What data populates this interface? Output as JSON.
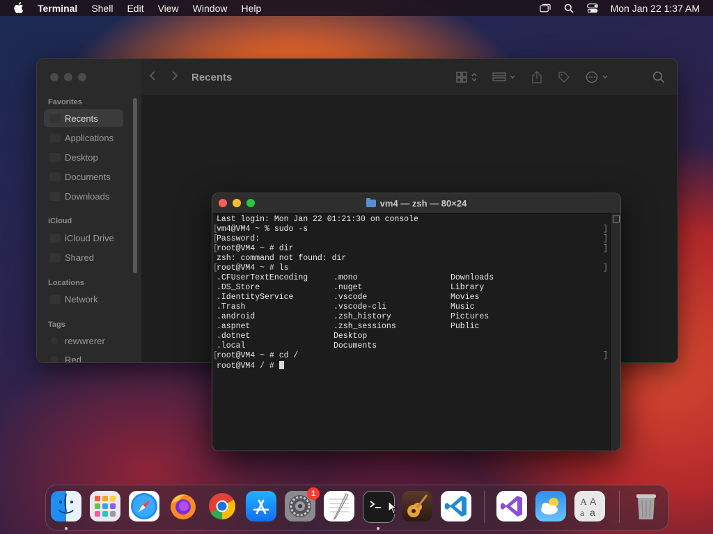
{
  "menubar": {
    "app_name": "Terminal",
    "menus": [
      "Shell",
      "Edit",
      "View",
      "Window",
      "Help"
    ],
    "clock": "Mon Jan 22  1:37 AM",
    "status_icons": [
      "screen-mirroring-icon",
      "spotlight-search-icon",
      "control-center-icon"
    ]
  },
  "finder": {
    "title": "Recents",
    "sections": {
      "favorites": "Favorites",
      "icloud": "iCloud",
      "locations": "Locations",
      "tags": "Tags"
    },
    "favorites": [
      "Recents",
      "Applications",
      "Desktop",
      "Documents",
      "Downloads"
    ],
    "icloud_items": [
      "iCloud Drive",
      "Shared"
    ],
    "locations_items": [
      "Network"
    ],
    "tags_items": [
      "rewwrerer",
      "Red"
    ],
    "selected": "Recents"
  },
  "terminal": {
    "title": "vm4 — zsh — 80×24",
    "lines": [
      "Last login: Mon Jan 22 01:21:30 on console",
      "vm4@VM4 ~ % sudo -s",
      "Password:",
      "root@VM4 ~ # dir",
      "zsh: command not found: dir",
      "root@VM4 ~ # ls"
    ],
    "ls_rows": [
      [
        ".CFUserTextEncoding",
        ".mono",
        "Downloads"
      ],
      [
        ".DS_Store",
        ".nuget",
        "Library"
      ],
      [
        ".IdentityService",
        ".vscode",
        "Movies"
      ],
      [
        ".Trash",
        ".vscode-cli",
        "Music"
      ],
      [
        ".android",
        ".zsh_history",
        "Pictures"
      ],
      [
        ".aspnet",
        ".zsh_sessions",
        "Public"
      ],
      [
        ".dotnet",
        "Desktop",
        ""
      ],
      [
        ".local",
        "Documents",
        ""
      ]
    ],
    "after_lines": [
      "root@VM4 ~ # cd /"
    ],
    "prompt": "root@VM4 / # "
  },
  "dock": {
    "apps": [
      {
        "name": "Finder",
        "running": true
      },
      {
        "name": "Launchpad",
        "running": false
      },
      {
        "name": "Safari",
        "running": false
      },
      {
        "name": "Firefox",
        "running": false
      },
      {
        "name": "Google Chrome",
        "running": false
      },
      {
        "name": "App Store",
        "running": false
      },
      {
        "name": "System Settings",
        "running": false,
        "badge": "1"
      },
      {
        "name": "TextEdit",
        "running": false
      },
      {
        "name": "Terminal",
        "running": true
      },
      {
        "name": "GarageBand",
        "running": false
      },
      {
        "name": "Visual Studio Code",
        "running": false
      },
      {
        "name": "Visual Studio",
        "running": false
      },
      {
        "name": "Weather",
        "running": false
      },
      {
        "name": "Font Book",
        "running": false
      },
      {
        "name": "Trash",
        "running": false
      }
    ]
  },
  "colors": {
    "close": "#ff5f57",
    "minimize": "#febc2e",
    "zoom": "#28c840",
    "badge": "#ff3b30"
  }
}
